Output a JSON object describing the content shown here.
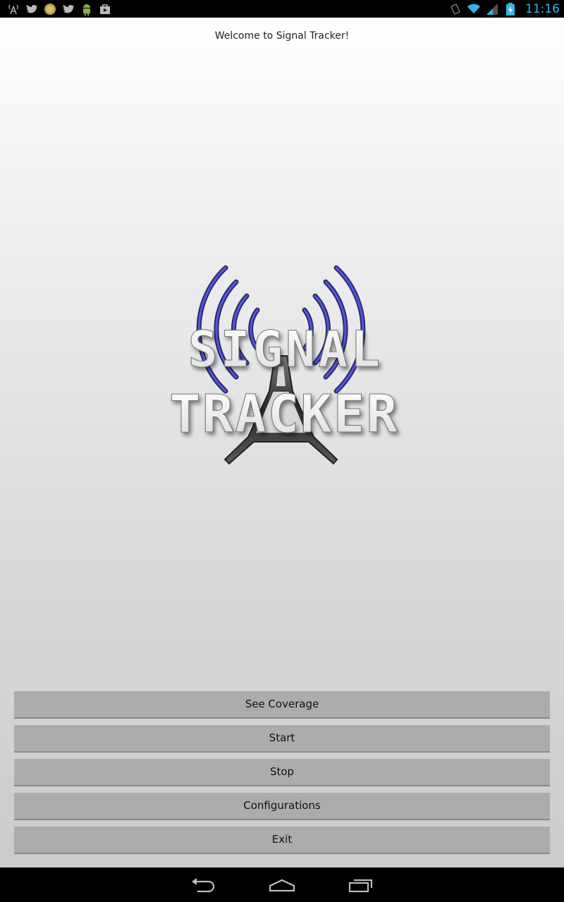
{
  "status_bar": {
    "notification_icons": [
      "signal-tower-icon",
      "twitter-icon",
      "coin-icon",
      "twitter-icon",
      "android-icon",
      "shopping-bag-icon"
    ],
    "system_icons": [
      "rotate-icon",
      "wifi-icon",
      "cell-signal-icon",
      "battery-charging-icon"
    ],
    "time": "11:16",
    "accent_color": "#33b5e5"
  },
  "app": {
    "welcome_text": "Welcome to Signal Tracker!",
    "logo": {
      "line1": "SIGNAL",
      "line2": "TRACKER",
      "wave_color": "#4a4ad8"
    },
    "buttons": {
      "see_coverage": "See Coverage",
      "start": "Start",
      "stop": "Stop",
      "configurations": "Configurations",
      "exit": "Exit"
    }
  },
  "nav_bar": {
    "items": [
      "back-icon",
      "home-icon",
      "recent-apps-icon"
    ]
  }
}
